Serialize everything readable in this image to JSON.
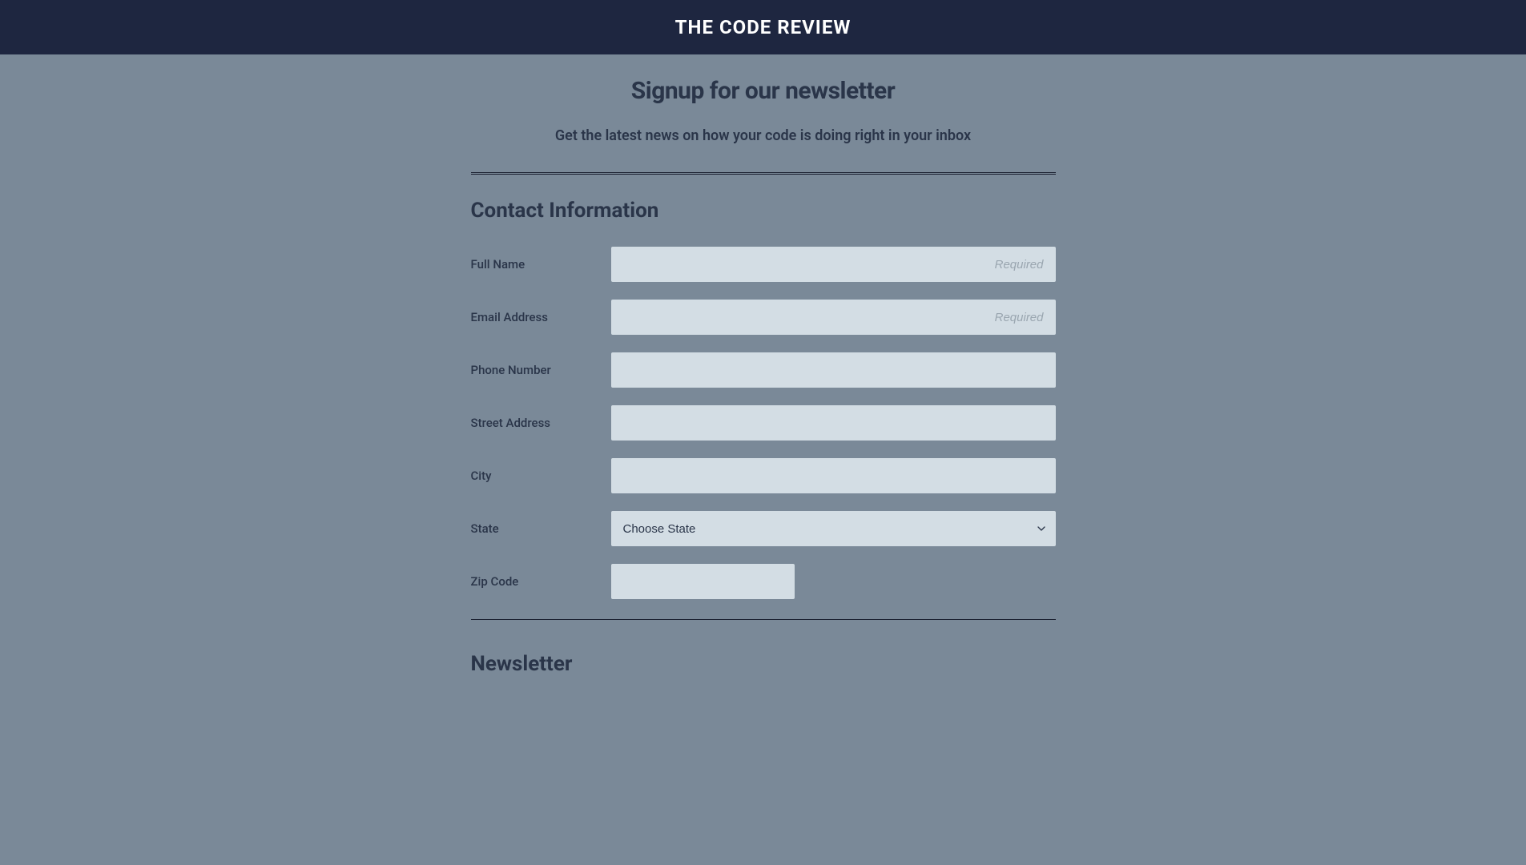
{
  "header": {
    "title": "THE CODE REVIEW"
  },
  "page": {
    "title": "Signup for our newsletter",
    "subtitle": "Get the latest news on how your code is doing right in your inbox"
  },
  "sections": {
    "contact": {
      "title": "Contact Information",
      "fields": {
        "fullName": {
          "label": "Full Name",
          "placeholder": "Required",
          "value": ""
        },
        "email": {
          "label": "Email Address",
          "placeholder": "Required",
          "value": ""
        },
        "phone": {
          "label": "Phone Number",
          "placeholder": "",
          "value": ""
        },
        "street": {
          "label": "Street Address",
          "placeholder": "",
          "value": ""
        },
        "city": {
          "label": "City",
          "placeholder": "",
          "value": ""
        },
        "state": {
          "label": "State",
          "selected": "Choose State"
        },
        "zip": {
          "label": "Zip Code",
          "placeholder": "",
          "value": ""
        }
      }
    },
    "newsletter": {
      "title": "Newsletter"
    }
  }
}
